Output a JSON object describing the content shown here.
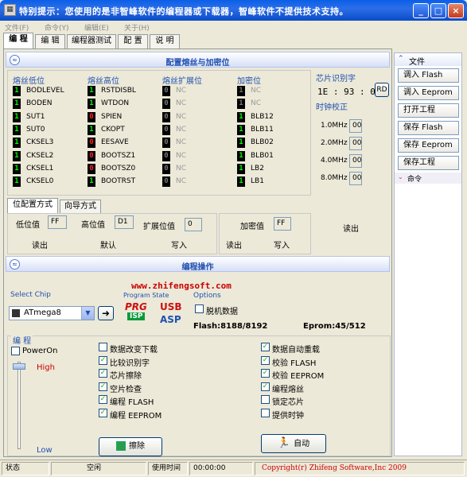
{
  "window": {
    "title": "特别提示：您使用的是非智峰软件的编程器或下载器，智峰软件不提供技术支持。",
    "min": "_",
    "max": "□",
    "close": "×"
  },
  "menu": [
    "文件(F)",
    "命令(Y)",
    "编辑(E)",
    "关于(H)"
  ],
  "tabs": [
    "编 程",
    "编 辑",
    "编程器测试",
    "配 置",
    "说 明"
  ],
  "fuse_section": {
    "title": "配置熔丝与加密位",
    "groups": [
      {
        "title": "熔丝低位",
        "items": [
          {
            "bit": "1",
            "name": "BODLEVEL"
          },
          {
            "bit": "1",
            "name": "BODEN"
          },
          {
            "bit": "1",
            "name": "SUT1"
          },
          {
            "bit": "1",
            "name": "SUT0"
          },
          {
            "bit": "1",
            "name": "CKSEL3"
          },
          {
            "bit": "1",
            "name": "CKSEL2"
          },
          {
            "bit": "1",
            "name": "CKSEL1"
          },
          {
            "bit": "1",
            "name": "CKSEL0"
          }
        ]
      },
      {
        "title": "熔丝高位",
        "items": [
          {
            "bit": "1",
            "name": "RSTDISBL"
          },
          {
            "bit": "1",
            "name": "WTDON"
          },
          {
            "bit": "0",
            "name": "SPIEN"
          },
          {
            "bit": "1",
            "name": "CKOPT"
          },
          {
            "bit": "0",
            "name": "EESAVE"
          },
          {
            "bit": "0",
            "name": "BOOTSZ1"
          },
          {
            "bit": "0",
            "name": "BOOTSZ0"
          },
          {
            "bit": "1",
            "name": "BOOTRST"
          }
        ]
      },
      {
        "title": "熔丝扩展位",
        "items": [
          {
            "bit": "0",
            "name": "NC"
          },
          {
            "bit": "0",
            "name": "NC"
          },
          {
            "bit": "0",
            "name": "NC"
          },
          {
            "bit": "0",
            "name": "NC"
          },
          {
            "bit": "0",
            "name": "NC"
          },
          {
            "bit": "0",
            "name": "NC"
          },
          {
            "bit": "0",
            "name": "NC"
          },
          {
            "bit": "0",
            "name": "NC"
          }
        ]
      },
      {
        "title": "加密位",
        "items": [
          {
            "bit": "1",
            "name": "NC"
          },
          {
            "bit": "1",
            "name": "NC"
          },
          {
            "bit": "1",
            "name": "BLB12"
          },
          {
            "bit": "1",
            "name": "BLB11"
          },
          {
            "bit": "1",
            "name": "BLB02"
          },
          {
            "bit": "1",
            "name": "BLB01"
          },
          {
            "bit": "1",
            "name": "LB2"
          },
          {
            "bit": "1",
            "name": "LB1"
          }
        ]
      }
    ],
    "chip_id": {
      "title": "芯片识别字",
      "value": "1E : 93 : 07",
      "rd": "RD"
    },
    "clock": {
      "title": "时钟校正",
      "rows": [
        {
          "label": "1.0MHz",
          "value": "00"
        },
        {
          "label": "2.0MHz",
          "value": "00"
        },
        {
          "label": "4.0MHz",
          "value": "00"
        },
        {
          "label": "8.0MHz",
          "value": "00"
        }
      ]
    },
    "subtabs": [
      "位配置方式",
      "向导方式"
    ],
    "low_label": "低位值",
    "low_value": "FF",
    "high_label": "高位值",
    "high_value": "D1",
    "ext_label": "扩展位值",
    "ext_value": "0",
    "lock_label": "加密值",
    "lock_value": "FF",
    "read": "读出",
    "default": "默认",
    "write": "写入",
    "read2": "读出",
    "write2": "写入",
    "read3": "读出"
  },
  "prog_section": {
    "title": "编程操作",
    "website": "www.zhifengsoft.com",
    "select_chip_label": "Select Chip",
    "chip": "ATmega8",
    "program_state_label": "Program State",
    "prg": "PRG",
    "isp": "ISP",
    "usb": "USB",
    "asp": "ASP",
    "options_label": "Options",
    "offline": "脱机数据",
    "flash_info": "Flash:8188/8192",
    "eprom_info": "Eprom:45/512",
    "prog_label": "编 程",
    "poweron": "PowerOn",
    "high": "High",
    "low": "Low",
    "checks_left": [
      {
        "label": "数据改变下载",
        "checked": false
      },
      {
        "label": "比较识别字",
        "checked": true
      },
      {
        "label": "芯片擦除",
        "checked": true
      },
      {
        "label": "空片检查",
        "checked": true
      },
      {
        "label": "编程 FLASH",
        "checked": true
      },
      {
        "label": "编程 EEPROM",
        "checked": true
      }
    ],
    "checks_right": [
      {
        "label": "数据自动重载",
        "checked": true
      },
      {
        "label": "校验 FLASH",
        "checked": true
      },
      {
        "label": "校验 EEPROM",
        "checked": true
      },
      {
        "label": "编程熔丝",
        "checked": true
      },
      {
        "label": "锁定芯片",
        "checked": false
      },
      {
        "label": "提供时钟",
        "checked": false
      }
    ],
    "erase_btn": "擦除",
    "auto_btn": "自动"
  },
  "right_panel": {
    "file_header": "文件",
    "buttons": [
      "调入 Flash",
      "调入 Eeprom",
      "打开工程",
      "保存 Flash",
      "保存 Eeprom",
      "保存工程"
    ],
    "cmd_header": "命令"
  },
  "status": {
    "label": "状态",
    "state": "空闲",
    "time_label": "使用时间",
    "time": "00:00:00",
    "copyright": "Copyright(r) Zhifeng Software,Inc 2009"
  },
  "colors": {
    "bit_one": "#00ff00",
    "bit_zero": "#ff2222",
    "website": "#cc0000",
    "copyright": "#cc0000"
  }
}
